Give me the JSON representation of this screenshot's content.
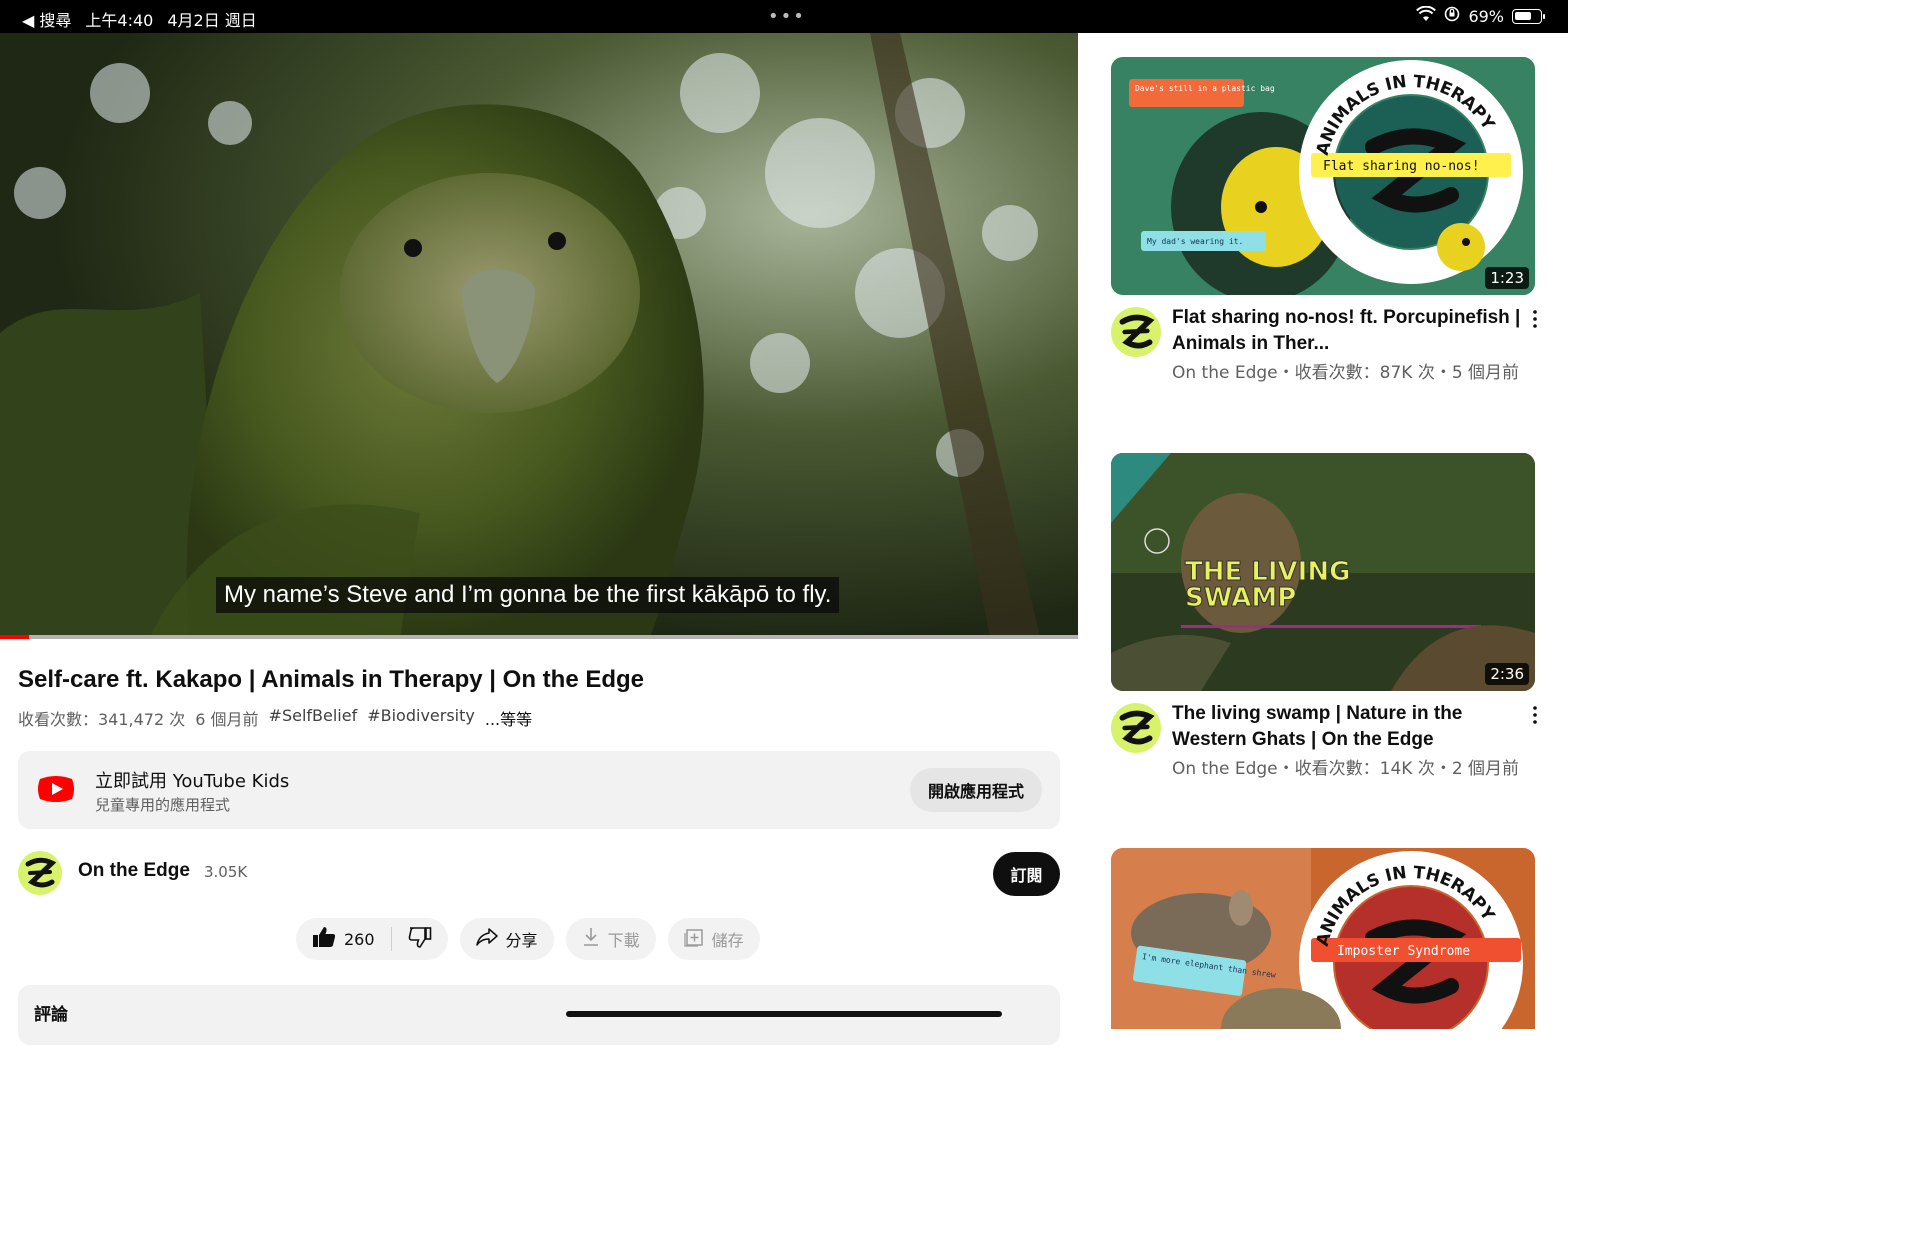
{
  "status_bar": {
    "back_label": "◀ 搜尋",
    "time": "上午4:40",
    "date": "4月2日 週日",
    "more_dots": "•••",
    "battery": "69%",
    "battery_level": 0.69
  },
  "player": {
    "caption": "My name’s Steve and I’m gonna be the first kākāpō to fly.",
    "progress": 0.027
  },
  "video": {
    "title": "Self-care ft. Kakapo | Animals in Therapy | On the Edge",
    "views": "收看次數：341,472 次",
    "age": "6 個月前",
    "tags": [
      "#SelfBelief",
      "#Biodiversity"
    ],
    "more": "...等等"
  },
  "promo": {
    "title": "立即試用 YouTube Kids",
    "subtitle": "兒童專用的應用程式",
    "button": "開啟應用程式"
  },
  "channel": {
    "name": "On the Edge",
    "subscribers": "3.05K",
    "subscribe_label": "訂閱"
  },
  "actions": {
    "likes": "260",
    "share": "分享",
    "download": "下載",
    "save": "儲存"
  },
  "comments": {
    "label": "評論"
  },
  "recommendations": [
    {
      "title": "Flat sharing no-nos! ft. Porcupinefish | Animals in Ther...",
      "meta": "On the Edge・收看次數：87K 次・5 個月前",
      "duration": "1:23",
      "thumb_texts": {
        "badge": "ANIMALS IN THERAPY",
        "banner": "Flat sharing no-nos!",
        "note1": "Dave's still in a plastic bag",
        "note2": "My dad's wearing it."
      }
    },
    {
      "title": "The living swamp | Nature in the Western Ghats | On the Edge",
      "meta": "On the Edge・收看次數：14K 次・2 個月前",
      "duration": "2:36",
      "thumb_texts": {
        "line1": "THE LIVING",
        "line2": "SWAMP"
      }
    },
    {
      "title": "",
      "meta": "",
      "duration": "",
      "thumb_texts": {
        "badge": "ANIMALS IN THERAPY",
        "banner": "Imposter Syndrome",
        "note1": "I'm more elephant than shrew"
      }
    }
  ],
  "colors": {
    "brand_red": "#ff0000",
    "channel_avatar": "#d8f36b",
    "subscribe_bg": "#0f0f0f",
    "pill_bg": "#f2f2f2"
  }
}
